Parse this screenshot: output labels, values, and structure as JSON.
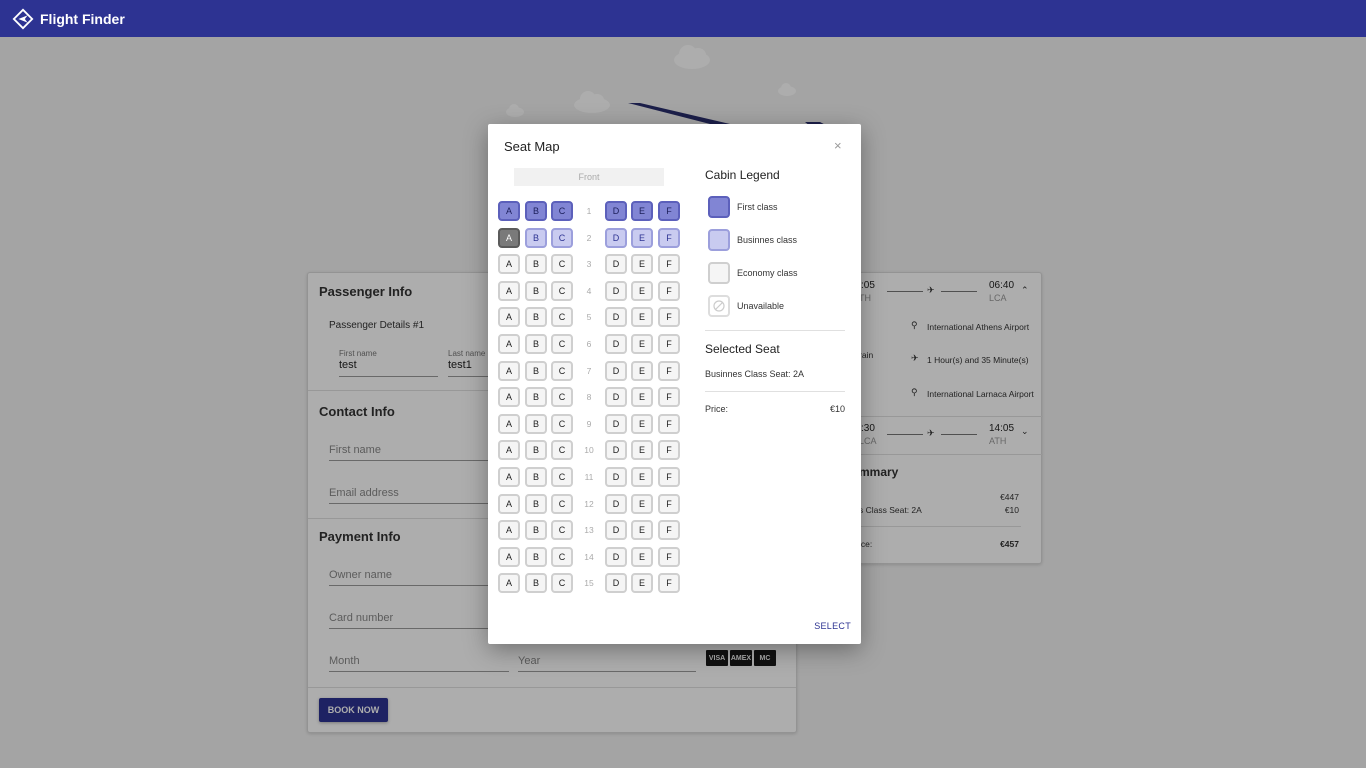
{
  "app": {
    "brand": "Flight Finder"
  },
  "form": {
    "passenger_title": "Passenger Info",
    "passenger_details": "Passenger Details #1",
    "first_name_label": "First name",
    "first_name_value": "test",
    "last_name_label": "Last name",
    "last_name_value": "test1",
    "contact_title": "Contact Info",
    "contact_first_name_placeholder": "First name",
    "email_placeholder": "Email address",
    "payment_title": "Payment Info",
    "owner_placeholder": "Owner name",
    "card_placeholder": "Card number",
    "month_placeholder": "Month",
    "year_placeholder": "Year",
    "card_brands": [
      "VISA",
      "AMEX",
      "MC"
    ],
    "book_label": "BOOK NOW"
  },
  "flight": {
    "outbound": {
      "dep_time": ":05",
      "dep_code": "TH",
      "arr_time": "06:40",
      "arr_code": "LCA"
    },
    "details": {
      "origin": "International Athens Airport",
      "duration": "1 Hour(s) and 35 Minute(s)",
      "destination": "International Larnaca Airport",
      "side_fragment": "rain"
    },
    "return": {
      "dep_time": ":30",
      "dep_code": "LCA",
      "arr_time": "14:05",
      "arr_code": "ATH"
    },
    "summary": {
      "title": "mmary",
      "base_price": "€447",
      "seat_label": "s Class Seat: 2A",
      "seat_price": "€10",
      "total_label": "ice:",
      "total": "€457"
    }
  },
  "seatmap": {
    "title": "Seat Map",
    "close_icon": "×",
    "front_label": "Front",
    "columns_left": [
      "A",
      "B",
      "C"
    ],
    "columns_right": [
      "D",
      "E",
      "F"
    ],
    "rows": [
      1,
      2,
      3,
      4,
      5,
      6,
      7,
      8,
      9,
      10,
      11,
      12,
      13,
      14,
      15
    ],
    "first_class_rows": [
      1
    ],
    "business_class_rows": [
      2
    ],
    "selected_seat": "2A",
    "legend": {
      "title": "Cabin Legend",
      "items": [
        {
          "class": "first",
          "label": "First class"
        },
        {
          "class": "business",
          "label": "Businnes class"
        },
        {
          "class": "economy",
          "label": "Economy class"
        },
        {
          "class": "unavailable",
          "label": "Unavailable"
        }
      ]
    },
    "selected": {
      "title": "Selected Seat",
      "text": "Businnes Class Seat: 2A",
      "price_label": "Price:",
      "price_value": "€10"
    },
    "select_label": "SELECT"
  },
  "colors": {
    "primary": "#2d3392",
    "first_class": "#8185d4",
    "business_class": "#c9cbf0",
    "economy_class": "#f5f5f5",
    "selected_seat": "#7a7a7a"
  }
}
